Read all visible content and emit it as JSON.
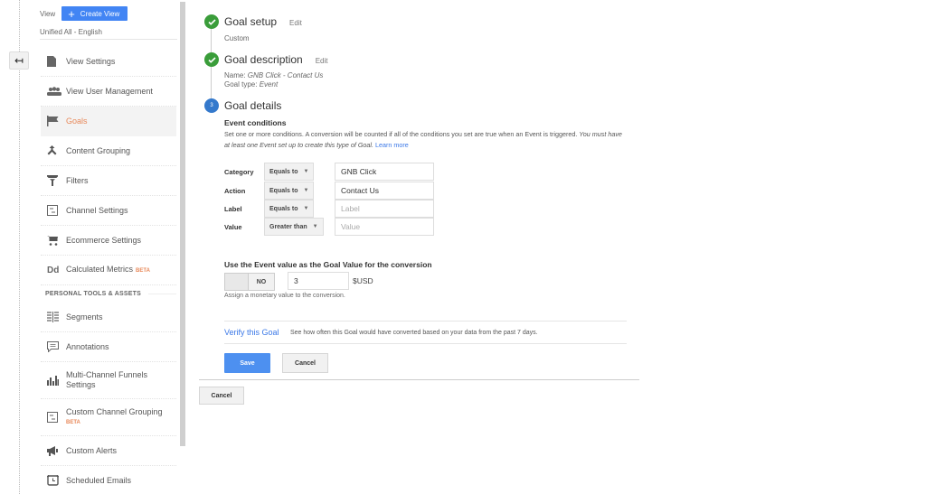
{
  "rail": {
    "back_icon": "↤"
  },
  "sidebar": {
    "view_label": "View",
    "create_view_label": "Create View",
    "view_name": "Unified All - English",
    "items": [
      {
        "label": "View Settings",
        "icon": "document-icon",
        "glyph": "▬"
      },
      {
        "label": "View User Management",
        "icon": "users-icon",
        "glyph": "👥"
      },
      {
        "label": "Goals",
        "icon": "flag-icon",
        "glyph": "⚑",
        "active": true
      },
      {
        "label": "Content Grouping",
        "icon": "content-grouping-icon",
        "glyph": "⋏"
      },
      {
        "label": "Filters",
        "icon": "filter-icon",
        "glyph": "⏷"
      },
      {
        "label": "Channel Settings",
        "icon": "channel-settings-icon",
        "glyph": "⊟"
      },
      {
        "label": "Ecommerce Settings",
        "icon": "cart-icon",
        "glyph": "🛒"
      },
      {
        "label": "Calculated Metrics",
        "icon": "calculated-metrics-icon",
        "glyph": "Dd",
        "badge": "BETA"
      }
    ],
    "section_header": "PERSONAL TOOLS & ASSETS",
    "personal_items": [
      {
        "label": "Segments",
        "icon": "segments-icon",
        "glyph": "☰"
      },
      {
        "label": "Annotations",
        "icon": "annotation-icon",
        "glyph": "🗨"
      },
      {
        "label": "Multi-Channel Funnels Settings",
        "icon": "bar-chart-icon",
        "glyph": "▮"
      },
      {
        "label": "Custom Channel Grouping",
        "icon": "channel-grouping-icon",
        "glyph": "⊟",
        "badge": "BETA"
      },
      {
        "label": "Custom Alerts",
        "icon": "megaphone-icon",
        "glyph": "📢"
      },
      {
        "label": "Scheduled Emails",
        "icon": "alarm-clock-icon",
        "glyph": "⏰"
      }
    ]
  },
  "steps": {
    "setup": {
      "title": "Goal setup",
      "edit": "Edit",
      "sub": "Custom"
    },
    "description": {
      "title": "Goal description",
      "edit": "Edit",
      "name_label": "Name:",
      "name_value": "GNB Click - Contact Us",
      "type_label": "Goal type:",
      "type_value": "Event"
    },
    "details": {
      "number": "3",
      "title": "Goal details"
    }
  },
  "event_conditions": {
    "title": "Event conditions",
    "desc": "Set one or more conditions. A conversion will be counted if all of the conditions you set are true when an Event is triggered.",
    "desc_italic": "You must have at least one Event set up to create this type of Goal.",
    "learn_more": "Learn more",
    "rows": [
      {
        "label": "Category",
        "operator": "Equals to",
        "value": "GNB Click",
        "placeholder": ""
      },
      {
        "label": "Action",
        "operator": "Equals to",
        "value": "Contact Us",
        "placeholder": ""
      },
      {
        "label": "Label",
        "operator": "Equals to",
        "value": "",
        "placeholder": "Label"
      },
      {
        "label": "Value",
        "operator": "Greater than",
        "value": "",
        "placeholder": "Value"
      }
    ]
  },
  "goal_value": {
    "title": "Use the Event value as the Goal Value for the conversion",
    "toggle_label": "NO",
    "amount": "3",
    "currency": "$USD",
    "help": "Assign a monetary value to the conversion."
  },
  "verify": {
    "link": "Verify this Goal",
    "desc": "See how often this Goal would have converted based on your data from the past 7 days."
  },
  "buttons": {
    "save": "Save",
    "cancel": "Cancel",
    "outer_cancel": "Cancel"
  },
  "colors": {
    "accent_blue": "#4285f4",
    "active_orange": "#e8895a",
    "check_green": "#3a9d3a",
    "step_blue": "#3479cc"
  }
}
